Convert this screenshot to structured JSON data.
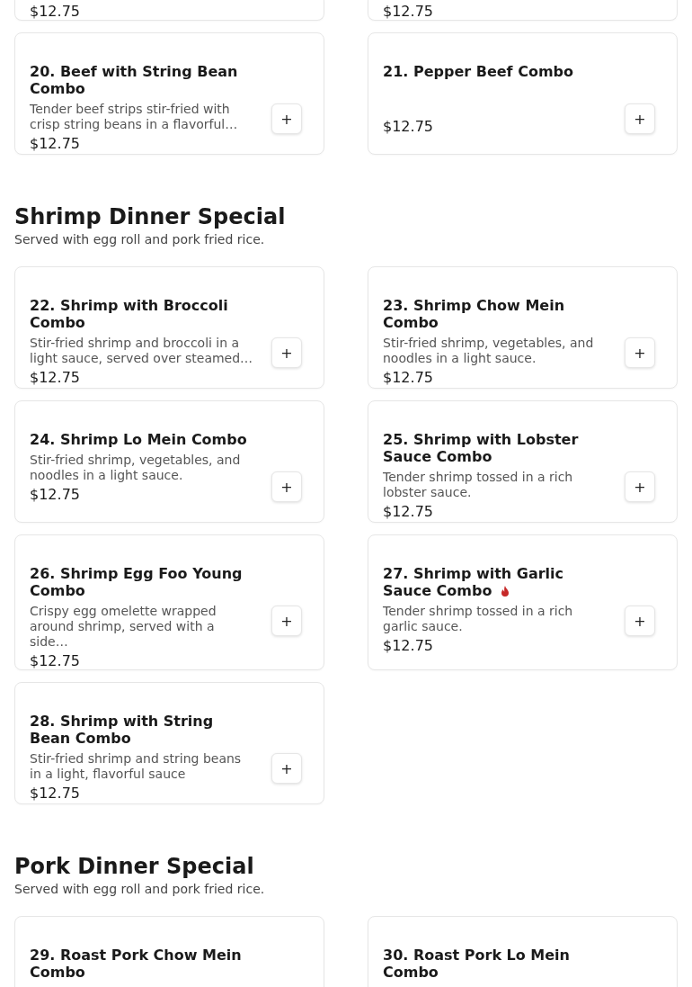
{
  "sections": [
    {
      "items": [
        {
          "price": "$12.75"
        },
        {
          "price": "$12.75"
        },
        {
          "name": "20. Beef with String Bean Combo",
          "description": "Tender beef strips stir-fried with crisp string beans in a flavorful…",
          "price": "$12.75",
          "spicy": false,
          "add_button": "+"
        },
        {
          "name": "21. Pepper Beef Combo",
          "price": "$12.75",
          "spicy": false,
          "add_button": "+"
        }
      ]
    },
    {
      "title": "Shrimp Dinner Special",
      "subtitle": "Served with egg roll and pork fried rice.",
      "items": [
        {
          "name": "22. Shrimp with Broccoli Combo",
          "description": "Stir-fried shrimp and broccoli in a light sauce, served over steamed…",
          "price": "$12.75",
          "spicy": false,
          "add_button": "+"
        },
        {
          "name": "23. Shrimp Chow Mein Combo",
          "description": "Stir-fried shrimp, vegetables, and noodles in a light sauce.",
          "price": "$12.75",
          "spicy": false,
          "add_button": "+"
        },
        {
          "name": "24. Shrimp Lo Mein Combo",
          "description": "Stir-fried shrimp, vegetables, and noodles in a light sauce.",
          "price": "$12.75",
          "spicy": false,
          "add_button": "+"
        },
        {
          "name": "25. Shrimp with Lobster Sauce Combo",
          "description": "Tender shrimp tossed in a rich lobster sauce.",
          "price": "$12.75",
          "spicy": false,
          "add_button": "+"
        },
        {
          "name": "26. Shrimp Egg Foo Young Combo",
          "description": "Crispy egg omelette wrapped around shrimp, served with a side…",
          "price": "$12.75",
          "spicy": false,
          "add_button": "+"
        },
        {
          "name": "27. Shrimp with Garlic Sauce Combo",
          "description": "Tender shrimp tossed in a rich garlic sauce.",
          "price": "$12.75",
          "spicy": true,
          "add_button": "+"
        },
        {
          "name": "28. Shrimp with String Bean Combo",
          "description": "Stir-fried shrimp and string beans in a light, flavorful sauce",
          "price": "$12.75",
          "spicy": false,
          "add_button": "+"
        }
      ]
    },
    {
      "title": "Pork Dinner Special",
      "subtitle": "Served with egg roll and pork fried rice.",
      "items": [
        {
          "name": "29. Roast Pork Chow Mein Combo",
          "spicy": false
        },
        {
          "name": "30. Roast Pork Lo Mein Combo",
          "spicy": false
        }
      ]
    }
  ]
}
